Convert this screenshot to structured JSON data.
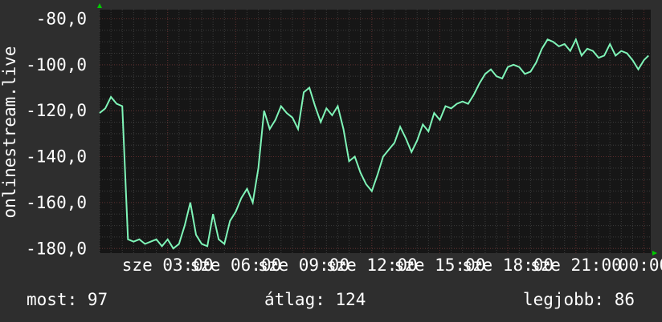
{
  "chart_data": {
    "type": "line",
    "ylabel": "onlinestream.live",
    "ylim": [
      -182,
      -76
    ],
    "y_ticks": [
      "-80,0",
      "-100,0",
      "-120,0",
      "-140,0",
      "-160,0",
      "-180,0"
    ],
    "y_tick_values": [
      -80,
      -100,
      -120,
      -140,
      -160,
      -180
    ],
    "x_ticks": [
      "sze 03:00",
      "sze 06:00",
      "sze 09:00",
      "sze 12:00",
      "sze 15:00",
      "sze 18:00",
      "sze 21:00",
      "00:00"
    ],
    "x_tick_hours": [
      3,
      6,
      9,
      12,
      15,
      18,
      21,
      24
    ],
    "xlim_hours": [
      0,
      24.3
    ],
    "grid": true,
    "series": [
      {
        "color": "#7ff5b8",
        "x_hours": [
          0,
          0.25,
          0.5,
          0.75,
          1.0,
          1.25,
          1.5,
          1.75,
          2.0,
          2.25,
          2.5,
          2.75,
          3.0,
          3.25,
          3.5,
          3.75,
          4.0,
          4.25,
          4.5,
          4.75,
          5.0,
          5.25,
          5.5,
          5.75,
          6.0,
          6.25,
          6.5,
          6.75,
          7.0,
          7.25,
          7.5,
          7.75,
          8.0,
          8.25,
          8.5,
          8.75,
          9.0,
          9.25,
          9.5,
          9.75,
          10.0,
          10.25,
          10.5,
          10.75,
          11.0,
          11.25,
          11.5,
          11.75,
          12.0,
          12.25,
          12.5,
          12.75,
          13.0,
          13.25,
          13.5,
          13.75,
          14.0,
          14.25,
          14.5,
          14.75,
          15.0,
          15.25,
          15.5,
          15.75,
          16.0,
          16.25,
          16.5,
          16.75,
          17.0,
          17.25,
          17.5,
          17.75,
          18.0,
          18.25,
          18.5,
          18.75,
          19.0,
          19.25,
          19.5,
          19.75,
          20.0,
          20.25,
          20.5,
          20.75,
          21.0,
          21.25,
          21.5,
          21.75,
          22.0,
          22.25,
          22.5,
          22.75,
          23.0,
          23.25,
          23.5,
          23.75,
          24.0,
          24.2
        ],
        "values": [
          -121,
          -119,
          -114,
          -117,
          -118,
          -176,
          -177,
          -176,
          -178,
          -177,
          -176,
          -179,
          -176,
          -180,
          -178,
          -170,
          -160,
          -174,
          -178,
          -179,
          -165,
          -176,
          -178,
          -168,
          -164,
          -158,
          -154,
          -160,
          -145,
          -120,
          -128,
          -124,
          -118,
          -121,
          -123,
          -128,
          -112,
          -110,
          -118,
          -125,
          -119,
          -122,
          -118,
          -128,
          -142,
          -140,
          -147,
          -152,
          -155,
          -148,
          -140,
          -137,
          -134,
          -127,
          -132,
          -138,
          -133,
          -126,
          -129,
          -121,
          -124,
          -118,
          -119,
          -117,
          -116,
          -117,
          -113,
          -108,
          -104,
          -102,
          -105,
          -106,
          -101,
          -100,
          -101,
          -104,
          -103,
          -99,
          -93,
          -89,
          -90,
          -92,
          -91,
          -94,
          -89,
          -96,
          -93,
          -94,
          -97,
          -96,
          -91,
          -96,
          -94,
          -95,
          -98,
          -102,
          -98,
          -96,
          -99,
          -100,
          -101,
          -97
        ]
      }
    ]
  },
  "stats": {
    "current": "most: 97",
    "average": "átlag: 124",
    "max": "legjobb: 86"
  },
  "colors": {
    "background": "#2e2e2e",
    "plot_background": "#161616",
    "grid": "#3c3c3c",
    "grid_major": "#5a2a2a",
    "line": "#7ff5b8",
    "arrow": "#00cc00"
  }
}
